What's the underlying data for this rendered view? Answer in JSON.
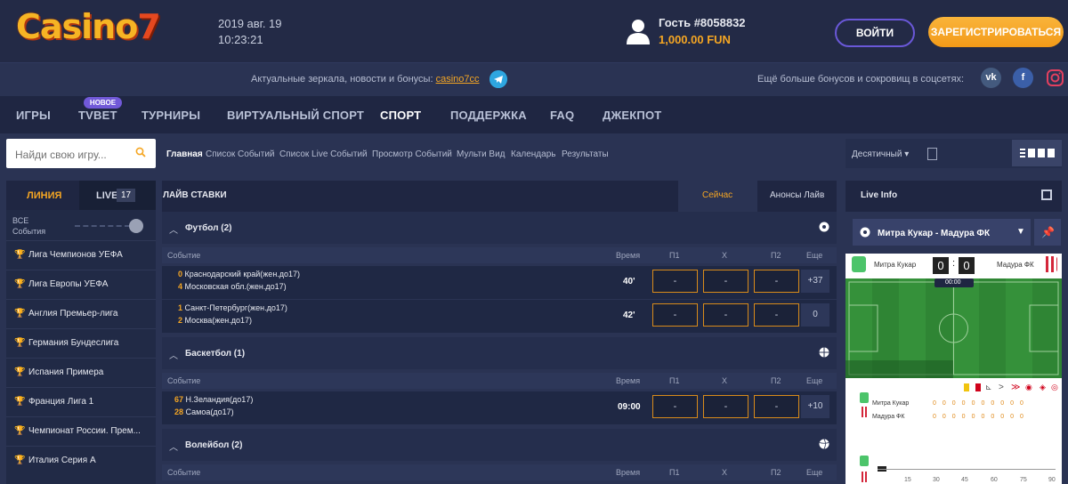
{
  "header": {
    "logo": "Casino",
    "logo_seven": "7",
    "date": "2019 авг. 19",
    "time": "10:23:21",
    "guest": "Гость #8058832",
    "balance": "1,000.00 FUN",
    "login": "ВОЙТИ",
    "register": "ЗАРЕГИСТРИРОВАТЬСЯ"
  },
  "promo": {
    "text": "Актуальные зеркала, новости и бонусы:",
    "link": "casino7cc",
    "social_text": "Ещё больше бонусов и сокровищ в соцсетях:",
    "vk": "vk",
    "fb": "f"
  },
  "nav": {
    "items": [
      "ИГРЫ",
      "TVBET",
      "ТУРНИРЫ",
      "ВИРТУАЛЬНЫЙ СПОРТ",
      "СПОРТ",
      "ПОДДЕРЖКА",
      "FAQ",
      "ДЖЕКПОТ"
    ],
    "badge": "НОВОЕ"
  },
  "search": {
    "placeholder": "Найди свою игру..."
  },
  "breadcrumbs": [
    "Главная",
    "Список Событий",
    "Список Live Событий",
    "Просмотр Событий",
    "Мульти Вид",
    "Календарь",
    "Результаты"
  ],
  "sidebar": {
    "tab_line": "ЛИНИЯ",
    "tab_live": "LIVE",
    "live_count": "17",
    "all_events_1": "ВСЕ",
    "all_events_2": "События",
    "leagues": [
      "Лига Чемпионов УЕФА",
      "Лига Европы УЕФА",
      "Англия Премьер-лига",
      "Германия Бундеслига",
      "Испания Примера",
      "Франция Лига 1",
      "Чемпионат России. Прем...",
      "Италия Серия А"
    ]
  },
  "center": {
    "title": "ЛАЙВ СТАВКИ",
    "tab_now": "Сейчас",
    "tab_announce": "Анонсы Лайв",
    "columns": {
      "event": "Событие",
      "time": "Время",
      "p1": "П1",
      "x": "Х",
      "p2": "П2",
      "more": "Еще"
    },
    "sports": [
      {
        "name": "Футбол (2)",
        "events": [
          {
            "s1": "0",
            "t1": "Краснодарский край(жен.до17)",
            "s2": "4",
            "t2": "Московская обл.(жен.до17)",
            "time": "40'",
            "p1": "-",
            "x": "-",
            "p2": "-",
            "more": "+37"
          },
          {
            "s1": "1",
            "t1": "Санкт-Петербург(жен.до17)",
            "s2": "2",
            "t2": "Москва(жен.до17)",
            "time": "42'",
            "p1": "-",
            "x": "-",
            "p2": "-",
            "more": "0"
          }
        ]
      },
      {
        "name": "Баскетбол (1)",
        "events": [
          {
            "s1": "67",
            "t1": "Н.Зеландия(до17)",
            "s2": "28",
            "t2": "Самоа(до17)",
            "time": "09:00",
            "p1": "-",
            "x": "-",
            "p2": "-",
            "more": "+10"
          }
        ]
      },
      {
        "name": "Волейбол (2)",
        "events": []
      }
    ]
  },
  "right": {
    "odds_format": "Десятичный",
    "live_info": "Live Info",
    "match": "Митра Кукар - Мадура ФК",
    "home": "Митра Кукар",
    "away": "Мадура ФК",
    "home_score": "0",
    "away_score": "0",
    "clock": "00:00",
    "stat_home": "Митра Кукар",
    "stat_away": "Мадура ФК",
    "timeline": [
      "15",
      "30",
      "45",
      "60",
      "75",
      "90"
    ]
  },
  "colors": {
    "accent": "#f5a623",
    "bg": "#2a3353",
    "purple": "#6a58d8"
  }
}
